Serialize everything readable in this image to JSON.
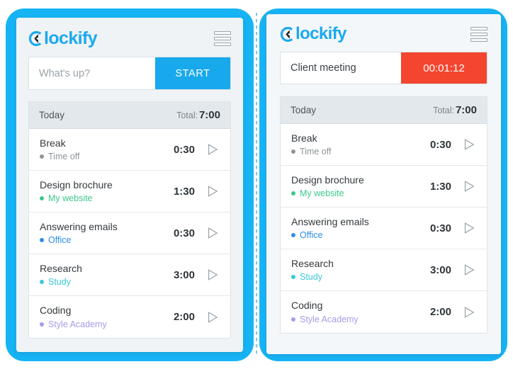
{
  "theme": {
    "brand_blue": "#1BA9F0",
    "frame_blue": "#16B4F5",
    "stop_red": "#F4452F",
    "panel_bg": "#EFF3F6",
    "day_header_bg": "#E3E8ED"
  },
  "panels": [
    {
      "id": "left",
      "brand": {
        "name": "lockify",
        "logo_letter": "C",
        "mark_icon": "clockify-c-icon"
      },
      "menu": {
        "icon": "hamburger-menu-icon",
        "label": "Menu"
      },
      "timer": {
        "state": "idle",
        "input_value": "",
        "placeholder": "What's up?",
        "action_label": "START",
        "action_kind": "start"
      },
      "day": {
        "label": "Today",
        "total_prefix": "Total:",
        "total_value": "7:00"
      },
      "entries": [
        {
          "title": "Break",
          "project": "Time off",
          "color": "#8D9499",
          "duration": "0:30",
          "play_icon": "play-icon"
        },
        {
          "title": "Design brochure",
          "project": "My website",
          "color": "#3CC98C",
          "duration": "1:30",
          "play_icon": "play-icon"
        },
        {
          "title": "Answering emails",
          "project": "Office",
          "color": "#2E8DE8",
          "duration": "0:30",
          "play_icon": "play-icon"
        },
        {
          "title": "Research",
          "project": "Study",
          "color": "#3BC8D8",
          "duration": "3:00",
          "play_icon": "play-icon"
        },
        {
          "title": "Coding",
          "project": "Style Academy",
          "color": "#A99BE8",
          "duration": "2:00",
          "play_icon": "play-icon"
        }
      ]
    },
    {
      "id": "right",
      "brand": {
        "name": "lockify",
        "logo_letter": "C",
        "mark_icon": "clockify-c-icon"
      },
      "menu": {
        "icon": "hamburger-menu-icon",
        "label": "Menu"
      },
      "timer": {
        "state": "running",
        "input_value": "Client meeting",
        "placeholder": "What's up?",
        "action_label": "00:01:12",
        "action_kind": "stop"
      },
      "day": {
        "label": "Today",
        "total_prefix": "Total:",
        "total_value": "7:00"
      },
      "entries": [
        {
          "title": "Break",
          "project": "Time off",
          "color": "#8D9499",
          "duration": "0:30",
          "play_icon": "play-icon"
        },
        {
          "title": "Design brochure",
          "project": "My website",
          "color": "#3CC98C",
          "duration": "1:30",
          "play_icon": "play-icon"
        },
        {
          "title": "Answering emails",
          "project": "Office",
          "color": "#2E8DE8",
          "duration": "0:30",
          "play_icon": "play-icon"
        },
        {
          "title": "Research",
          "project": "Study",
          "color": "#3BC8D8",
          "duration": "3:00",
          "play_icon": "play-icon"
        },
        {
          "title": "Coding",
          "project": "Style Academy",
          "color": "#A99BE8",
          "duration": "2:00",
          "play_icon": "play-icon"
        }
      ]
    }
  ]
}
